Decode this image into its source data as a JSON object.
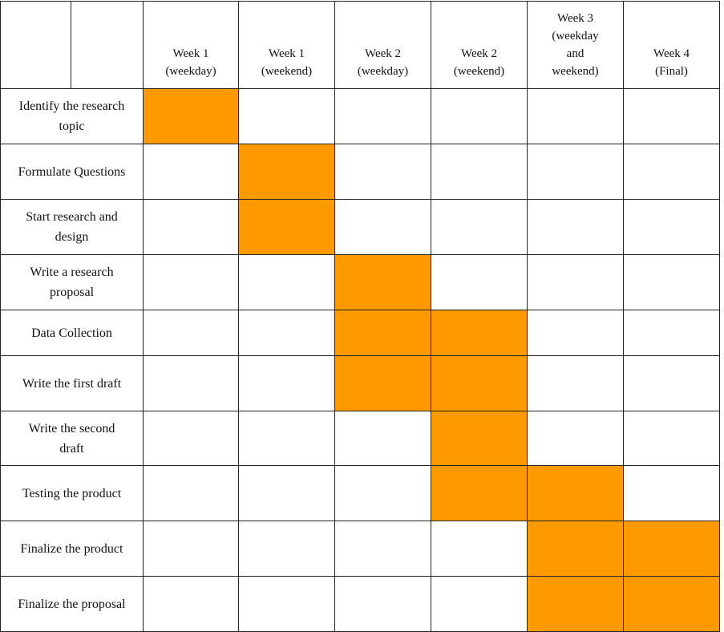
{
  "colors": {
    "active": "#FF9900",
    "grid": "#222222"
  },
  "columns": [
    "Week 1 (weekday)",
    "Week 1 (weekend)",
    "Week 2 (weekday)",
    "Week 2 (weekend)",
    "Week 3 (weekday and weekend)",
    "Week 4 (Final)"
  ],
  "tasks": [
    {
      "label": "Identify the research topic",
      "active": [
        0
      ]
    },
    {
      "label": "Formulate Questions",
      "active": [
        1
      ]
    },
    {
      "label": "Start research and design",
      "active": [
        1
      ]
    },
    {
      "label": "Write a research proposal",
      "active": [
        2
      ]
    },
    {
      "label": "Data Collection",
      "active": [
        2,
        3
      ]
    },
    {
      "label": "Write the first draft",
      "active": [
        2,
        3
      ]
    },
    {
      "label": "Write the second draft",
      "active": [
        3
      ]
    },
    {
      "label": "Testing the product",
      "active": [
        3,
        4
      ]
    },
    {
      "label": "Finalize the product",
      "active": [
        4,
        5
      ]
    },
    {
      "label": "Finalize the proposal",
      "active": [
        4,
        5
      ]
    }
  ]
}
